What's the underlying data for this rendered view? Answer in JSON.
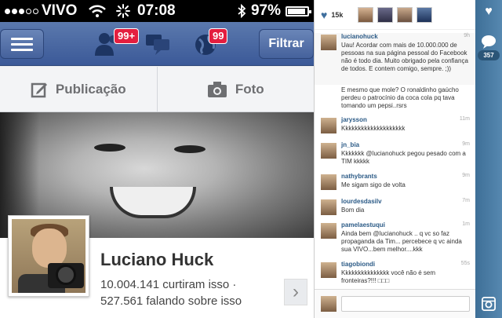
{
  "statusbar": {
    "carrier": "VIVO",
    "time": "07:08",
    "battery": "97%",
    "wifi_icon": "wifi-icon",
    "bluetooth_icon": "bluetooth-icon"
  },
  "navbar": {
    "friends_badge": "99+",
    "notifications_badge": "99",
    "filter_label": "Filtrar",
    "bar_color": "#3b5998"
  },
  "actions": {
    "publish_label": "Publicação",
    "photo_label": "Foto"
  },
  "profile": {
    "name": "Luciano Huck",
    "likes": "10.004.141 curtiram isso ·",
    "talking": "527.561 falando sobre isso"
  },
  "panel": {
    "likes_count": "15k",
    "comments": [
      {
        "user": "lucianohuck",
        "ago": "9h",
        "text": "Uau! Acordar com mais de 10.000.000 de pessoas na sua página pessoal do Facebook não é todo dia. Muito obrigado pela confiança de todos. E contem comigo, sempre. ;))"
      },
      {
        "user": "",
        "ago": "",
        "text": "E mesmo que mole? O ronaldinho gaúcho perdeu o patrocínio da coca cola pq tava tomando um pepsi..rsrs"
      },
      {
        "user": "jarysson",
        "ago": "11m",
        "text": "Kkkkkkkkkkkkkkkkkkkk"
      },
      {
        "user": "jn_bia",
        "ago": "9m",
        "text": "Kkkkkkk @lucianohuck pegou pesado com a TIM kkkkk"
      },
      {
        "user": "nathybrants",
        "ago": "9m",
        "text": "Me sigam sigo de volta"
      },
      {
        "user": "lourdesdasilv",
        "ago": "7m",
        "text": "Bom dia"
      },
      {
        "user": "pamelaestuqui",
        "ago": "1m",
        "text": "Ainda bem @lucianohuck .. q vc so faz propaganda da Tim... percebece q vc ainda sua VIVO...bem melhor....kkk"
      },
      {
        "user": "tiagobiondi",
        "ago": "55s",
        "text": "Kkkkkkkkkkkkkkk você não é sem fronteiras?!!! □□□"
      }
    ]
  },
  "strip": {
    "heart_icon": "heart-icon",
    "comment_icon": "comment-icon",
    "comments_count": "357",
    "instagram_icon": "instagram-icon"
  }
}
